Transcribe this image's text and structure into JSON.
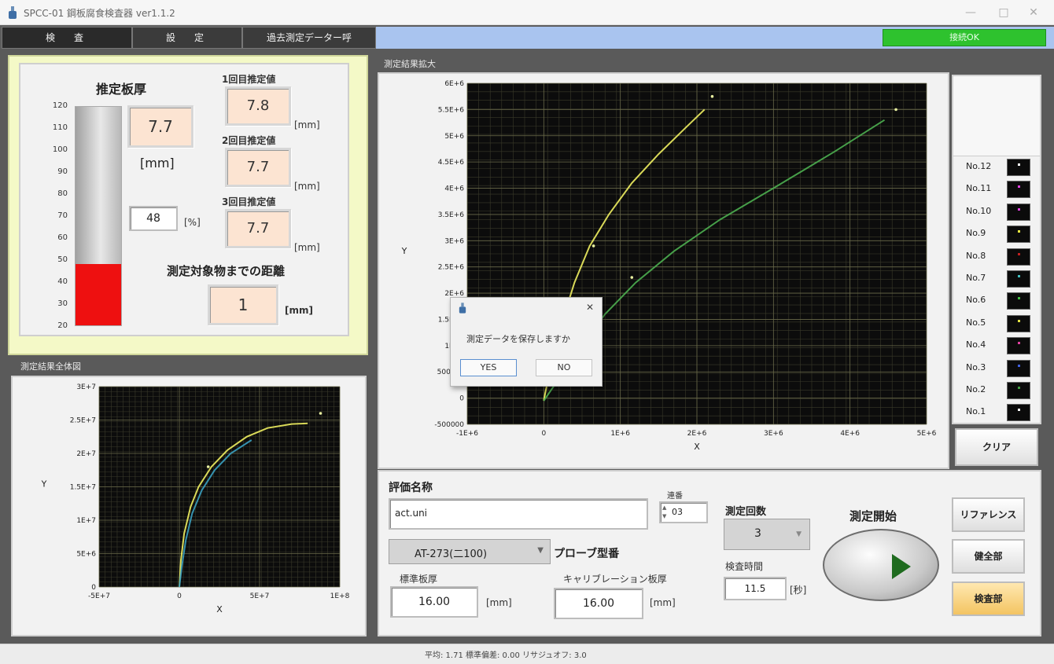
{
  "window": {
    "title": "SPCC-01 鋼板腐食検査器 ver1.1.2",
    "minimize": "—",
    "maximize": "□",
    "close": "✕"
  },
  "tabs": [
    "検　査",
    "設　定",
    "過去測定データー呼"
  ],
  "connection_status": "接続OK",
  "thickness": {
    "title": "推定板厚",
    "value": "7.7",
    "unit": "[mm]",
    "percent_value": "48",
    "percent_unit": "[%]",
    "gauge_level_percent": 48,
    "gauge_ticks": [
      "120",
      "110",
      "100",
      "90",
      "80",
      "70",
      "60",
      "50",
      "40",
      "30",
      "20"
    ],
    "est1_label": "1回目推定値",
    "est1_value": "7.8",
    "est2_label": "2回目推定値",
    "est2_value": "7.7",
    "est3_label": "3回目推定値",
    "est3_value": "7.7",
    "est_unit": "[mm]",
    "distance_label": "測定対象物までの距離",
    "distance_value": "1",
    "distance_unit": "[mm]"
  },
  "overall_graph_title": "測定結果全体図",
  "zoom_graph_title": "測定結果拡大",
  "legend": [
    "No.12",
    "No.11",
    "No.10",
    "No.9",
    "No.8",
    "No.7",
    "No.6",
    "No.5",
    "No.4",
    "No.3",
    "No.2",
    "No.1"
  ],
  "legend_colors": [
    "#ffffff",
    "#e040e0",
    "#e040e0",
    "#f0f040",
    "#c02020",
    "#40c0c0",
    "#40c040",
    "#e0e040",
    "#e040a0",
    "#4060e0",
    "#40a040",
    "#ffffff"
  ],
  "clear_label": "クリア",
  "dialog": {
    "message": "測定データを保存しますか",
    "yes": "YES",
    "no": "NO",
    "close": "✕"
  },
  "controls": {
    "name_label": "評価名称",
    "name_value": "act.uni",
    "serial_label": "連番",
    "serial_value": "03",
    "probe_value": "AT-273(二100)",
    "probe_label": "プローブ型番",
    "std_thickness_label": "標準板厚",
    "std_thickness_value": "16.00",
    "std_thickness_unit": "[mm]",
    "calib_label": "キャリブレーション板厚",
    "calib_value": "16.00",
    "calib_unit": "[mm]",
    "count_label": "測定回数",
    "count_value": "3",
    "time_label": "検査時間",
    "time_value": "11.5",
    "time_unit": "[秒]",
    "start_label": "測定開始",
    "reference_label": "リファレンス",
    "healthy_label": "健全部",
    "inspect_label": "検査部"
  },
  "status_text": "平均: 1.71 標準偏差: 0.00 リサジュオフ: 3.0",
  "chart_data": [
    {
      "type": "scatter",
      "xlabel": "X",
      "ylabel": "Y",
      "xlim": [
        -50000000.0,
        100000000.0
      ],
      "ylim": [
        0,
        30000000.0
      ],
      "xticks": [
        "-5E+7",
        "0",
        "5E+7",
        "1E+8"
      ],
      "yticks": [
        "0",
        "5E+6",
        "1E+7",
        "1.5E+7",
        "2E+7",
        "2.5E+7",
        "3E+7"
      ],
      "grid": true,
      "series": [
        {
          "x": [
            0,
            1000000.0,
            3000000.0,
            7000000.0,
            12000000.0,
            20000000.0,
            30000000.0,
            42000000.0,
            55000000.0,
            70000000.0,
            80000000.0
          ],
          "y": [
            0,
            4000000.0,
            8000000.0,
            12000000.0,
            15000000.0,
            18000000.0,
            20500000.0,
            22500000.0,
            23800000.0,
            24400000.0,
            24500000.0
          ],
          "color": "#f0f060"
        },
        {
          "x": [
            0,
            1500000.0,
            4000000.0,
            8000000.0,
            14000000.0,
            22000000.0,
            32000000.0,
            45000000.0
          ],
          "y": [
            0,
            3000000.0,
            7000000.0,
            11000000.0,
            14500000.0,
            17500000.0,
            20000000.0,
            22000000.0
          ],
          "color": "#3aa0c0"
        }
      ],
      "points": [
        {
          "x": 88000000.0,
          "y": 26000000.0
        },
        {
          "x": 18000000.0,
          "y": 18000000.0
        }
      ]
    },
    {
      "type": "scatter",
      "xlabel": "X",
      "ylabel": "Y",
      "xlim": [
        -1000000.0,
        5000000.0
      ],
      "ylim": [
        -500000,
        6000000.0
      ],
      "xticks": [
        "-1E+6",
        "0",
        "1E+6",
        "2E+6",
        "3E+6",
        "4E+6",
        "5E+6"
      ],
      "yticks": [
        "-500000",
        "0",
        "500000",
        "1E+6",
        "1.5E+6",
        "2E+6",
        "2.5E+6",
        "3E+6",
        "3.5E+6",
        "4E+6",
        "4.5E+6",
        "5E+6",
        "5.5E+6",
        "6E+6"
      ],
      "grid": true,
      "series": [
        {
          "x": [
            0,
            100000,
            250000,
            400000,
            600000,
            850000,
            1150000,
            1500000,
            1850000,
            2100000
          ],
          "y": [
            -50000,
            700000,
            1500000,
            2200000,
            2900000,
            3500000,
            4100000,
            4650000,
            5150000,
            5500000
          ],
          "color": "#f0f060"
        },
        {
          "x": [
            0,
            400000,
            800000,
            1200000,
            1700000,
            2300000,
            3000000,
            3800000,
            4450000
          ],
          "y": [
            -50000,
            800000,
            1600000,
            2200000,
            2800000,
            3400000,
            4000000,
            4700000,
            5300000
          ],
          "color": "#4caf50"
        }
      ],
      "points": [
        {
          "x": 2200000.0,
          "y": 5750000.0
        },
        {
          "x": 4600000.0,
          "y": 5500000.0
        },
        {
          "x": 650000,
          "y": 2900000.0
        },
        {
          "x": 1150000.0,
          "y": 2300000.0
        }
      ]
    }
  ]
}
